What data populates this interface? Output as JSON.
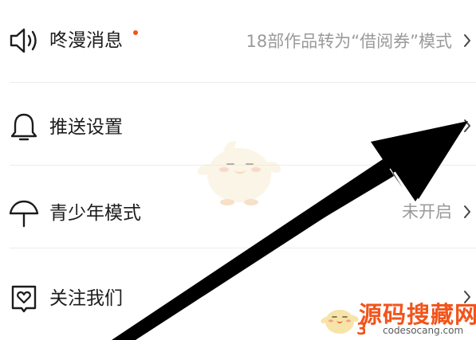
{
  "settings": {
    "items": [
      {
        "label": "咚漫消息",
        "icon": "speaker-icon",
        "value": "18部作品转为“借阅券”模式",
        "has_badge": true
      },
      {
        "label": "推送设置",
        "icon": "bell-icon",
        "value": "",
        "has_badge": false
      },
      {
        "label": "青少年模式",
        "icon": "umbrella-icon",
        "value": "未开启",
        "has_badge": false
      },
      {
        "label": "关注我们",
        "icon": "heart-card-icon",
        "value": "",
        "has_badge": false
      }
    ]
  },
  "colors": {
    "badge": "#f2541b",
    "label": "#1c1c1c",
    "value": "#9a9a9a",
    "divider": "#ececec",
    "watermark": "#f2541b"
  },
  "watermark": {
    "text": "源码搜藏网",
    "url": "codesocang.com",
    "mark": "3"
  }
}
